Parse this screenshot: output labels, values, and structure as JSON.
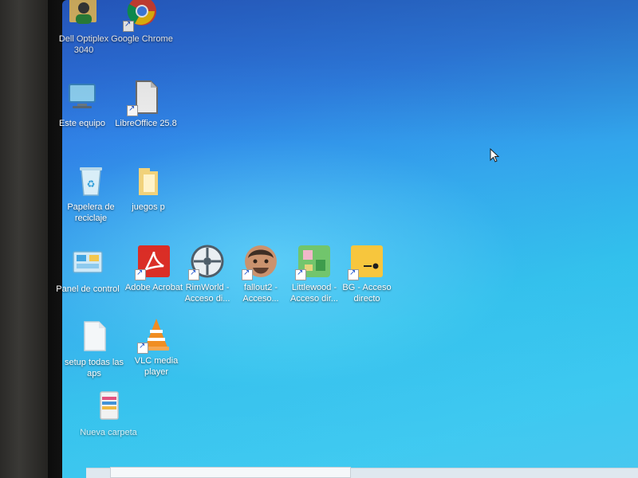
{
  "desktop_icons": [
    {
      "label": "Dell Optiplex 3040",
      "icon": "user-folder-icon"
    },
    {
      "label": "Google Chrome",
      "icon": "chrome-icon"
    },
    {
      "label": "Este equipo",
      "icon": "computer-icon"
    },
    {
      "label": "LibreOffice 25.8",
      "icon": "libreoffice-icon"
    },
    {
      "label": "Papelera de reciclaje",
      "icon": "recycle-bin-icon"
    },
    {
      "label": "juegos p",
      "icon": "folder-icon"
    },
    {
      "label": "Panel de control",
      "icon": "control-panel-icon"
    },
    {
      "label": "Adobe Acrobat",
      "icon": "acrobat-icon"
    },
    {
      "label": "RimWorld - Acceso di...",
      "icon": "rimworld-icon"
    },
    {
      "label": "fallout2 - Acceso...",
      "icon": "fallout-face-icon"
    },
    {
      "label": "Littlewood - Acceso dir...",
      "icon": "littlewood-icon"
    },
    {
      "label": "BG - Acceso directo",
      "icon": "yellow-face-icon"
    },
    {
      "label": "setup todas las aps",
      "icon": "document-icon"
    },
    {
      "label": "VLC media player",
      "icon": "vlc-icon"
    },
    {
      "label": "Nueva carpeta",
      "icon": "archive-icon"
    }
  ],
  "colors": {
    "desktop_top": "#2a63d8",
    "desktop_bottom": "#36c7f0",
    "acrobat_red": "#d92a22",
    "folder_yellow": "#f1d27a",
    "vlc_orange": "#f08a1c"
  }
}
